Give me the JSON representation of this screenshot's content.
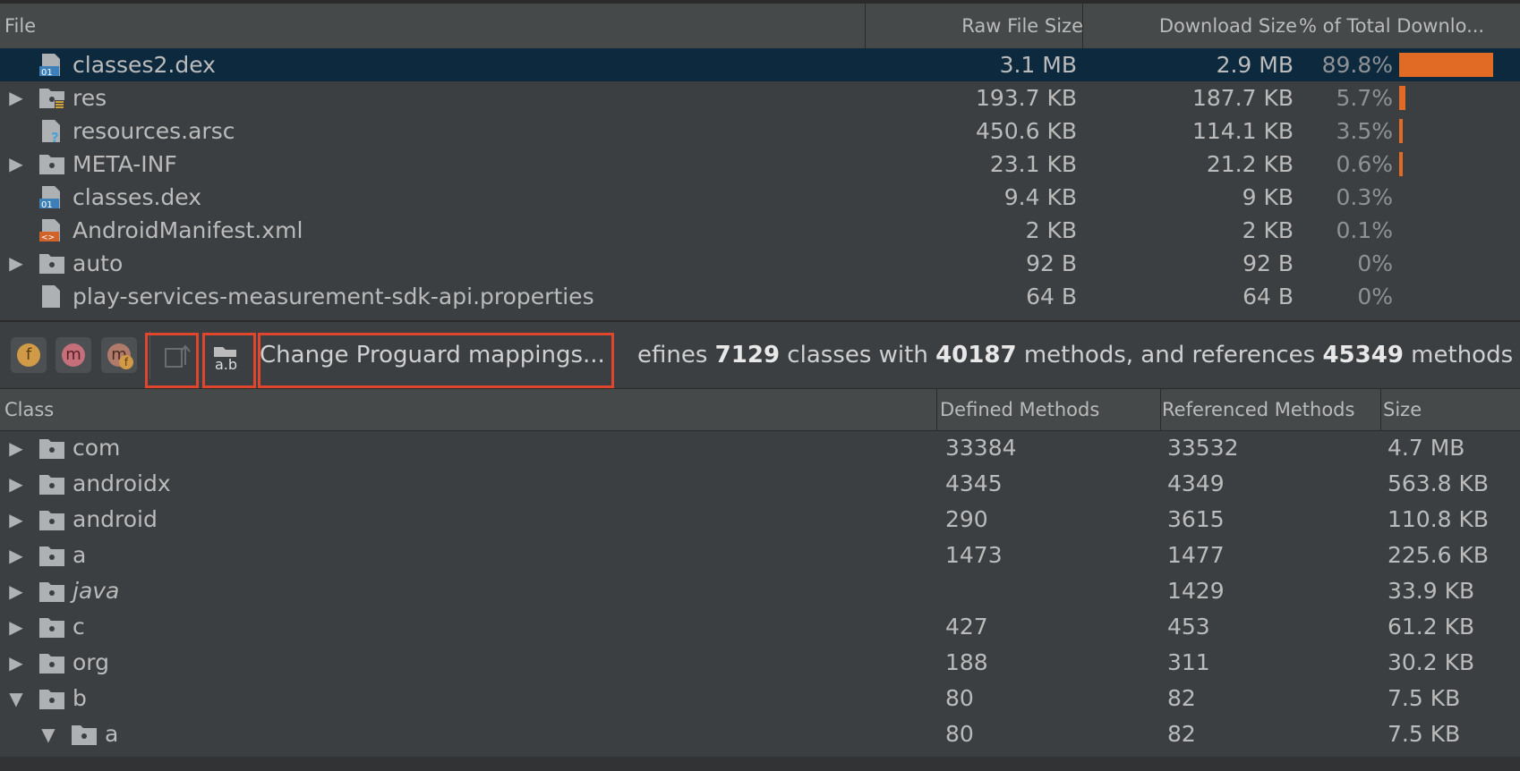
{
  "file_table": {
    "headers": {
      "file": "File",
      "raw": "Raw File Size",
      "download": "Download Size",
      "pct": "% of Total Downlo..."
    },
    "rows": [
      {
        "name": "classes2.dex",
        "icon": "dex-file-icon",
        "expandable": false,
        "raw": "3.1 MB",
        "download": "2.9 MB",
        "pct": "89.8%",
        "fraction": 0.898,
        "selected": true
      },
      {
        "name": "res",
        "icon": "resource-folder-icon",
        "expandable": true,
        "raw": "193.7 KB",
        "download": "187.7 KB",
        "pct": "5.7%",
        "fraction": 0.057
      },
      {
        "name": "resources.arsc",
        "icon": "unknown-file-icon",
        "expandable": false,
        "raw": "450.6 KB",
        "download": "114.1 KB",
        "pct": "3.5%",
        "fraction": 0.035
      },
      {
        "name": "META-INF",
        "icon": "folder-icon",
        "expandable": true,
        "raw": "23.1 KB",
        "download": "21.2 KB",
        "pct": "0.6%",
        "fraction": 0.006
      },
      {
        "name": "classes.dex",
        "icon": "dex-file-icon",
        "expandable": false,
        "raw": "9.4 KB",
        "download": "9 KB",
        "pct": "0.3%",
        "fraction": 0.003
      },
      {
        "name": "AndroidManifest.xml",
        "icon": "xml-file-icon",
        "expandable": false,
        "raw": "2 KB",
        "download": "2 KB",
        "pct": "0.1%",
        "fraction": 0.001
      },
      {
        "name": "auto",
        "icon": "folder-icon",
        "expandable": true,
        "raw": "92 B",
        "download": "92 B",
        "pct": "0%",
        "fraction": 0
      },
      {
        "name": "play-services-measurement-sdk-api.properties",
        "icon": "file-icon",
        "expandable": false,
        "raw": "64 B",
        "download": "64 B",
        "pct": "0%",
        "fraction": 0
      }
    ]
  },
  "toolbar": {
    "buttons": [
      {
        "name": "show-fields-button",
        "glyph": "f",
        "color": "#d19a46"
      },
      {
        "name": "show-methods-button",
        "glyph": "m",
        "color": "#c46f7a"
      },
      {
        "name": "show-referenced-only-button",
        "glyph": "m",
        "color": "#b07b6b"
      }
    ],
    "load_mapping_label": "Change Proguard mappings...",
    "summary": {
      "prefix": "efines ",
      "classes": "7129",
      "mid1": " classes with ",
      "methods": "40187",
      "mid2": " methods, and references ",
      "refs": "45349",
      "suffix": " methods."
    },
    "highlight_color": "#e0462e"
  },
  "class_table": {
    "headers": {
      "class": "Class",
      "defined": "Defined Methods",
      "referenced": "Referenced Methods",
      "size": "Size"
    },
    "rows": [
      {
        "name": "com",
        "level": 0,
        "state": "collapsed",
        "defined": "33384",
        "referenced": "33532",
        "size": "4.7 MB"
      },
      {
        "name": "androidx",
        "level": 0,
        "state": "collapsed",
        "defined": "4345",
        "referenced": "4349",
        "size": "563.8 KB"
      },
      {
        "name": "android",
        "level": 0,
        "state": "collapsed",
        "defined": "290",
        "referenced": "3615",
        "size": "110.8 KB"
      },
      {
        "name": "a",
        "level": 0,
        "state": "collapsed",
        "defined": "1473",
        "referenced": "1477",
        "size": "225.6 KB"
      },
      {
        "name": "java",
        "level": 0,
        "state": "collapsed",
        "defined": "",
        "referenced": "1429",
        "size": "33.9 KB",
        "italic": true
      },
      {
        "name": "c",
        "level": 0,
        "state": "collapsed",
        "defined": "427",
        "referenced": "453",
        "size": "61.2 KB"
      },
      {
        "name": "org",
        "level": 0,
        "state": "collapsed",
        "defined": "188",
        "referenced": "311",
        "size": "30.2 KB"
      },
      {
        "name": "b",
        "level": 0,
        "state": "expanded",
        "defined": "80",
        "referenced": "82",
        "size": "7.5 KB"
      },
      {
        "name": "a",
        "level": 1,
        "state": "expanded",
        "defined": "80",
        "referenced": "82",
        "size": "7.5 KB"
      }
    ]
  },
  "colors": {
    "background": "#3c3f41",
    "header": "#45494a",
    "selection": "#0d293e",
    "bar": "#e16b24",
    "text": "#bbbbbb"
  }
}
